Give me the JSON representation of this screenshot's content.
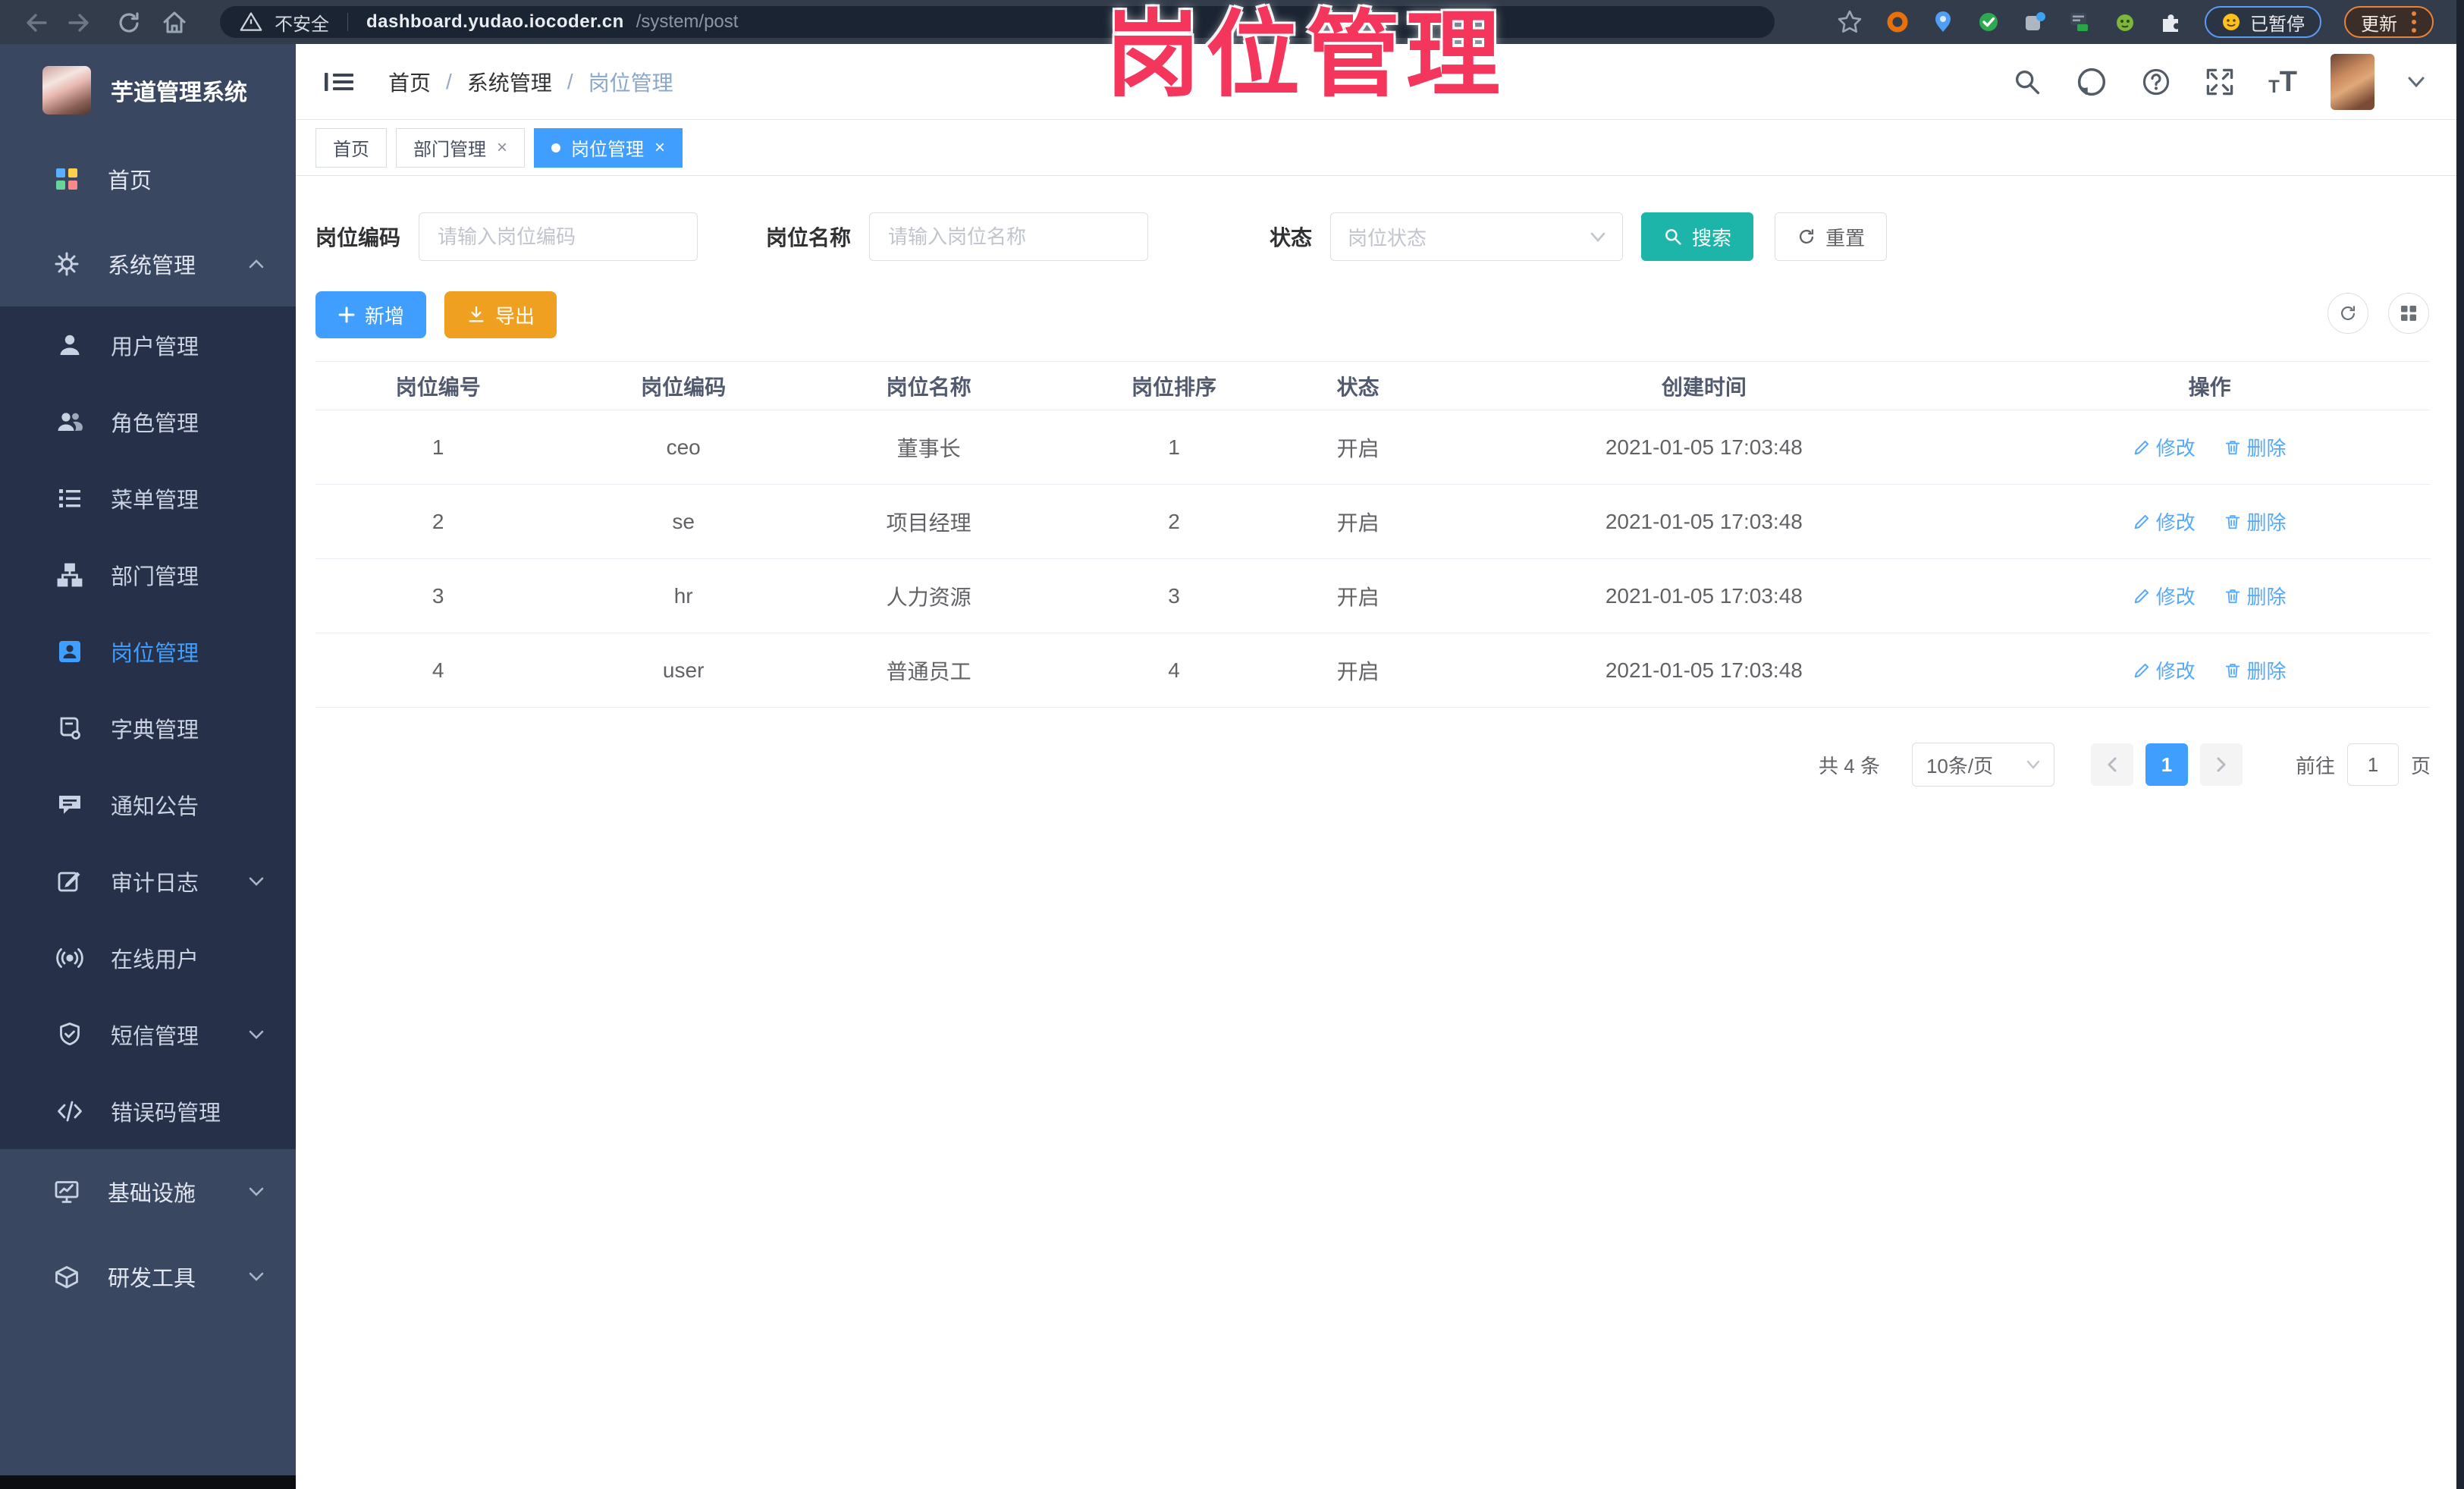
{
  "browser": {
    "security_label": "不安全",
    "url_domain": "dashboard.yudao.iocoder.cn",
    "url_path": "/system/post",
    "paused_badge": "已暂停",
    "update_button": "更新"
  },
  "overlay": {
    "title": "岗位管理",
    "color": "#f5365c"
  },
  "sidebar": {
    "app_title": "芋道管理系统",
    "items": [
      {
        "label": "首页"
      },
      {
        "label": "系统管理"
      },
      {
        "label": "用户管理"
      },
      {
        "label": "角色管理"
      },
      {
        "label": "菜单管理"
      },
      {
        "label": "部门管理"
      },
      {
        "label": "岗位管理",
        "active": true
      },
      {
        "label": "字典管理"
      },
      {
        "label": "通知公告"
      },
      {
        "label": "审计日志"
      },
      {
        "label": "在线用户"
      },
      {
        "label": "短信管理"
      },
      {
        "label": "错误码管理"
      },
      {
        "label": "基础设施"
      },
      {
        "label": "研发工具"
      }
    ]
  },
  "header": {
    "breadcrumb": [
      "首页",
      "系统管理",
      "岗位管理"
    ],
    "separator": "/"
  },
  "tabs": [
    {
      "label": "首页"
    },
    {
      "label": "部门管理"
    },
    {
      "label": "岗位管理"
    }
  ],
  "filters": {
    "fields": [
      {
        "label": "岗位编码",
        "placeholder": "请输入岗位编码"
      },
      {
        "label": "岗位名称",
        "placeholder": "请输入岗位名称"
      },
      {
        "label": "状态",
        "placeholder": "岗位状态"
      }
    ],
    "search_label": "搜索",
    "reset_label": "重置"
  },
  "toolbar": {
    "add_label": "新增",
    "export_label": "导出"
  },
  "table": {
    "headers": [
      "岗位编号",
      "岗位编码",
      "岗位名称",
      "岗位排序",
      "状态",
      "创建时间",
      "操作"
    ],
    "edit_label": "修改",
    "delete_label": "删除",
    "rows": [
      {
        "id": "1",
        "code": "ceo",
        "name": "董事长",
        "sort": "1",
        "status": "开启",
        "created": "2021-01-05 17:03:48"
      },
      {
        "id": "2",
        "code": "se",
        "name": "项目经理",
        "sort": "2",
        "status": "开启",
        "created": "2021-01-05 17:03:48"
      },
      {
        "id": "3",
        "code": "hr",
        "name": "人力资源",
        "sort": "3",
        "status": "开启",
        "created": "2021-01-05 17:03:48"
      },
      {
        "id": "4",
        "code": "user",
        "name": "普通员工",
        "sort": "4",
        "status": "开启",
        "created": "2021-01-05 17:03:48"
      }
    ]
  },
  "pagination": {
    "total": "共 4 条",
    "page_size": "10条/页",
    "current_page": "1",
    "goto_label": "前往",
    "goto_value": "1",
    "page_label": "页"
  }
}
